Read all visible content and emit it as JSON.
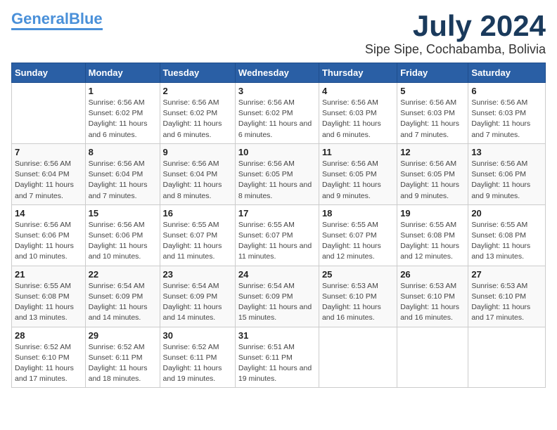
{
  "logo": {
    "general": "General",
    "blue": "Blue"
  },
  "header": {
    "month": "July 2024",
    "location": "Sipe Sipe, Cochabamba, Bolivia"
  },
  "weekdays": [
    "Sunday",
    "Monday",
    "Tuesday",
    "Wednesday",
    "Thursday",
    "Friday",
    "Saturday"
  ],
  "weeks": [
    [
      {
        "day": "",
        "sunrise": "",
        "sunset": "",
        "daylight": ""
      },
      {
        "day": "1",
        "sunrise": "Sunrise: 6:56 AM",
        "sunset": "Sunset: 6:02 PM",
        "daylight": "Daylight: 11 hours and 6 minutes."
      },
      {
        "day": "2",
        "sunrise": "Sunrise: 6:56 AM",
        "sunset": "Sunset: 6:02 PM",
        "daylight": "Daylight: 11 hours and 6 minutes."
      },
      {
        "day": "3",
        "sunrise": "Sunrise: 6:56 AM",
        "sunset": "Sunset: 6:02 PM",
        "daylight": "Daylight: 11 hours and 6 minutes."
      },
      {
        "day": "4",
        "sunrise": "Sunrise: 6:56 AM",
        "sunset": "Sunset: 6:03 PM",
        "daylight": "Daylight: 11 hours and 6 minutes."
      },
      {
        "day": "5",
        "sunrise": "Sunrise: 6:56 AM",
        "sunset": "Sunset: 6:03 PM",
        "daylight": "Daylight: 11 hours and 7 minutes."
      },
      {
        "day": "6",
        "sunrise": "Sunrise: 6:56 AM",
        "sunset": "Sunset: 6:03 PM",
        "daylight": "Daylight: 11 hours and 7 minutes."
      }
    ],
    [
      {
        "day": "7",
        "sunrise": "Sunrise: 6:56 AM",
        "sunset": "Sunset: 6:04 PM",
        "daylight": "Daylight: 11 hours and 7 minutes."
      },
      {
        "day": "8",
        "sunrise": "Sunrise: 6:56 AM",
        "sunset": "Sunset: 6:04 PM",
        "daylight": "Daylight: 11 hours and 7 minutes."
      },
      {
        "day": "9",
        "sunrise": "Sunrise: 6:56 AM",
        "sunset": "Sunset: 6:04 PM",
        "daylight": "Daylight: 11 hours and 8 minutes."
      },
      {
        "day": "10",
        "sunrise": "Sunrise: 6:56 AM",
        "sunset": "Sunset: 6:05 PM",
        "daylight": "Daylight: 11 hours and 8 minutes."
      },
      {
        "day": "11",
        "sunrise": "Sunrise: 6:56 AM",
        "sunset": "Sunset: 6:05 PM",
        "daylight": "Daylight: 11 hours and 9 minutes."
      },
      {
        "day": "12",
        "sunrise": "Sunrise: 6:56 AM",
        "sunset": "Sunset: 6:05 PM",
        "daylight": "Daylight: 11 hours and 9 minutes."
      },
      {
        "day": "13",
        "sunrise": "Sunrise: 6:56 AM",
        "sunset": "Sunset: 6:06 PM",
        "daylight": "Daylight: 11 hours and 9 minutes."
      }
    ],
    [
      {
        "day": "14",
        "sunrise": "Sunrise: 6:56 AM",
        "sunset": "Sunset: 6:06 PM",
        "daylight": "Daylight: 11 hours and 10 minutes."
      },
      {
        "day": "15",
        "sunrise": "Sunrise: 6:56 AM",
        "sunset": "Sunset: 6:06 PM",
        "daylight": "Daylight: 11 hours and 10 minutes."
      },
      {
        "day": "16",
        "sunrise": "Sunrise: 6:55 AM",
        "sunset": "Sunset: 6:07 PM",
        "daylight": "Daylight: 11 hours and 11 minutes."
      },
      {
        "day": "17",
        "sunrise": "Sunrise: 6:55 AM",
        "sunset": "Sunset: 6:07 PM",
        "daylight": "Daylight: 11 hours and 11 minutes."
      },
      {
        "day": "18",
        "sunrise": "Sunrise: 6:55 AM",
        "sunset": "Sunset: 6:07 PM",
        "daylight": "Daylight: 11 hours and 12 minutes."
      },
      {
        "day": "19",
        "sunrise": "Sunrise: 6:55 AM",
        "sunset": "Sunset: 6:08 PM",
        "daylight": "Daylight: 11 hours and 12 minutes."
      },
      {
        "day": "20",
        "sunrise": "Sunrise: 6:55 AM",
        "sunset": "Sunset: 6:08 PM",
        "daylight": "Daylight: 11 hours and 13 minutes."
      }
    ],
    [
      {
        "day": "21",
        "sunrise": "Sunrise: 6:55 AM",
        "sunset": "Sunset: 6:08 PM",
        "daylight": "Daylight: 11 hours and 13 minutes."
      },
      {
        "day": "22",
        "sunrise": "Sunrise: 6:54 AM",
        "sunset": "Sunset: 6:09 PM",
        "daylight": "Daylight: 11 hours and 14 minutes."
      },
      {
        "day": "23",
        "sunrise": "Sunrise: 6:54 AM",
        "sunset": "Sunset: 6:09 PM",
        "daylight": "Daylight: 11 hours and 14 minutes."
      },
      {
        "day": "24",
        "sunrise": "Sunrise: 6:54 AM",
        "sunset": "Sunset: 6:09 PM",
        "daylight": "Daylight: 11 hours and 15 minutes."
      },
      {
        "day": "25",
        "sunrise": "Sunrise: 6:53 AM",
        "sunset": "Sunset: 6:10 PM",
        "daylight": "Daylight: 11 hours and 16 minutes."
      },
      {
        "day": "26",
        "sunrise": "Sunrise: 6:53 AM",
        "sunset": "Sunset: 6:10 PM",
        "daylight": "Daylight: 11 hours and 16 minutes."
      },
      {
        "day": "27",
        "sunrise": "Sunrise: 6:53 AM",
        "sunset": "Sunset: 6:10 PM",
        "daylight": "Daylight: 11 hours and 17 minutes."
      }
    ],
    [
      {
        "day": "28",
        "sunrise": "Sunrise: 6:52 AM",
        "sunset": "Sunset: 6:10 PM",
        "daylight": "Daylight: 11 hours and 17 minutes."
      },
      {
        "day": "29",
        "sunrise": "Sunrise: 6:52 AM",
        "sunset": "Sunset: 6:11 PM",
        "daylight": "Daylight: 11 hours and 18 minutes."
      },
      {
        "day": "30",
        "sunrise": "Sunrise: 6:52 AM",
        "sunset": "Sunset: 6:11 PM",
        "daylight": "Daylight: 11 hours and 19 minutes."
      },
      {
        "day": "31",
        "sunrise": "Sunrise: 6:51 AM",
        "sunset": "Sunset: 6:11 PM",
        "daylight": "Daylight: 11 hours and 19 minutes."
      },
      {
        "day": "",
        "sunrise": "",
        "sunset": "",
        "daylight": ""
      },
      {
        "day": "",
        "sunrise": "",
        "sunset": "",
        "daylight": ""
      },
      {
        "day": "",
        "sunrise": "",
        "sunset": "",
        "daylight": ""
      }
    ]
  ]
}
